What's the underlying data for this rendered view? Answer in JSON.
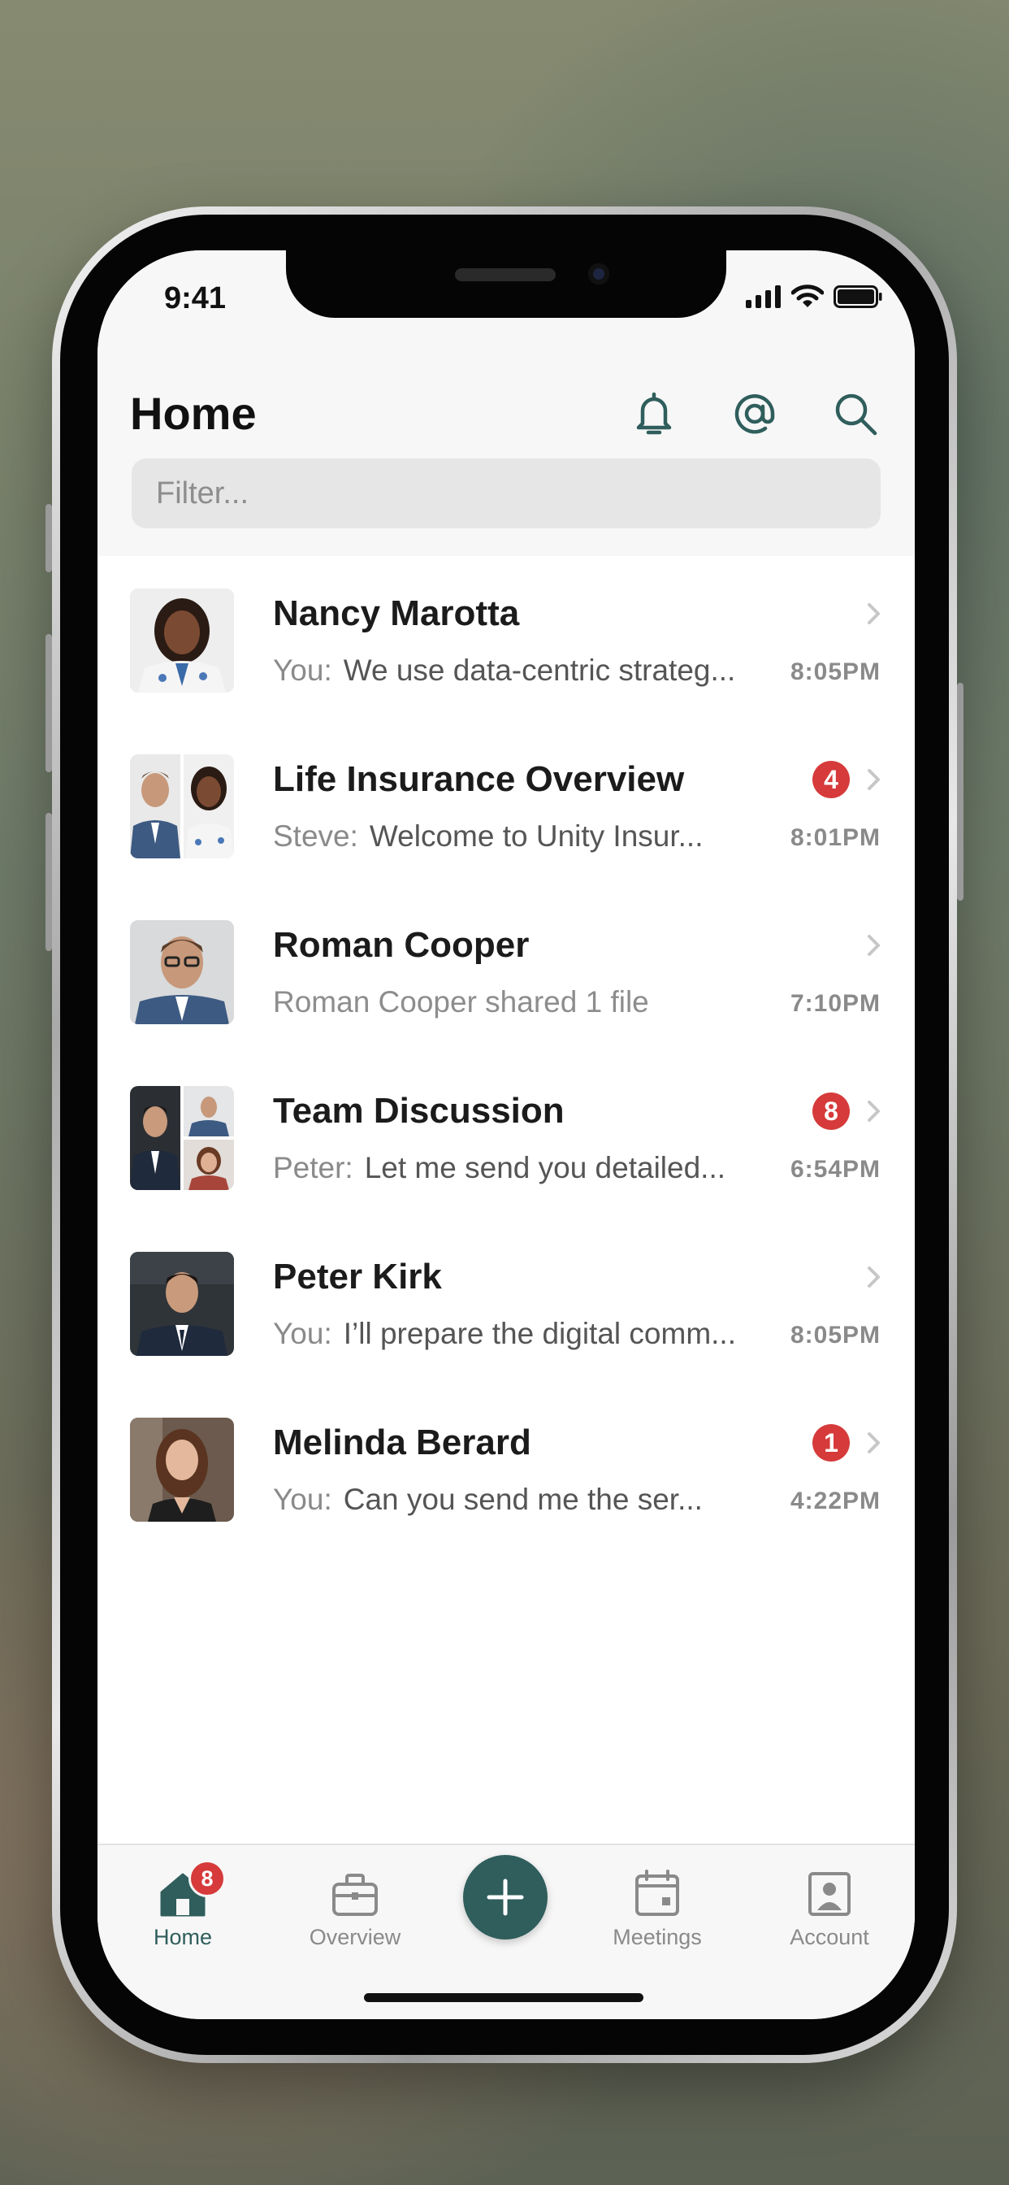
{
  "status_bar": {
    "time": "9:41"
  },
  "header": {
    "title": "Home",
    "filter_placeholder": "Filter..."
  },
  "icons": {
    "notifications": "bell-icon",
    "mentions": "at-sign-icon",
    "search": "search-icon"
  },
  "colors": {
    "accent": "#2f5e5c",
    "badge": "#d63a3a"
  },
  "conversations": [
    {
      "name": "Nancy Marotta",
      "sender": "You:",
      "message": "We use data-centric strateg...",
      "time": "8:05PM",
      "unread": ""
    },
    {
      "name": "Life Insurance Overview",
      "sender": "Steve:",
      "message": "Welcome to Unity Insur...",
      "time": "8:01PM",
      "unread": "4"
    },
    {
      "name": "Roman Cooper",
      "sender": "",
      "message": "Roman Cooper shared 1 file",
      "time": "7:10PM",
      "unread": ""
    },
    {
      "name": "Team Discussion",
      "sender": "Peter:",
      "message": "Let me send you detailed...",
      "time": "6:54PM",
      "unread": "8"
    },
    {
      "name": "Peter Kirk",
      "sender": "You:",
      "message": "I’ll prepare the digital comm...",
      "time": "8:05PM",
      "unread": ""
    },
    {
      "name": "Melinda Berard",
      "sender": "You:",
      "message": "Can you send me the ser...",
      "time": "4:22PM",
      "unread": "1"
    }
  ],
  "tabbar": {
    "home": {
      "label": "Home",
      "badge": "8"
    },
    "overview": {
      "label": "Overview"
    },
    "meetings": {
      "label": "Meetings"
    },
    "account": {
      "label": "Account"
    }
  }
}
